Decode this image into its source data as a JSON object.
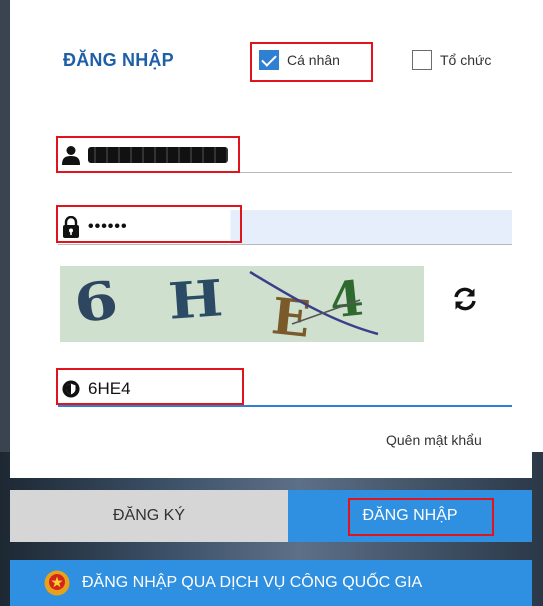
{
  "login": {
    "title": "ĐĂNG NHẬP",
    "account_types": [
      {
        "label": "Cá nhân",
        "checked": true
      },
      {
        "label": "Tổ chức",
        "checked": false
      }
    ],
    "password_masked": "••••••",
    "captcha": {
      "chars": [
        "6",
        "H",
        "E",
        "4"
      ],
      "input_value": "6HE4"
    },
    "forgot_password": "Quên mật khẩu",
    "register_button": "ĐĂNG KÝ",
    "login_button": "ĐĂNG NHẬP",
    "gov_login": "ĐĂNG NHẬP QUA DỊCH VỤ CÔNG QUỐC GIA"
  },
  "colors": {
    "accent_blue": "#2f8fe0",
    "title_blue": "#1f5fa8",
    "highlight_red": "#e0141c",
    "register_gray": "#d6d6d6",
    "captcha_bg": "#cfe0cf"
  },
  "icons": [
    "user-icon",
    "lock-icon",
    "shield-icon",
    "refresh-icon",
    "national-emblem-icon"
  ]
}
